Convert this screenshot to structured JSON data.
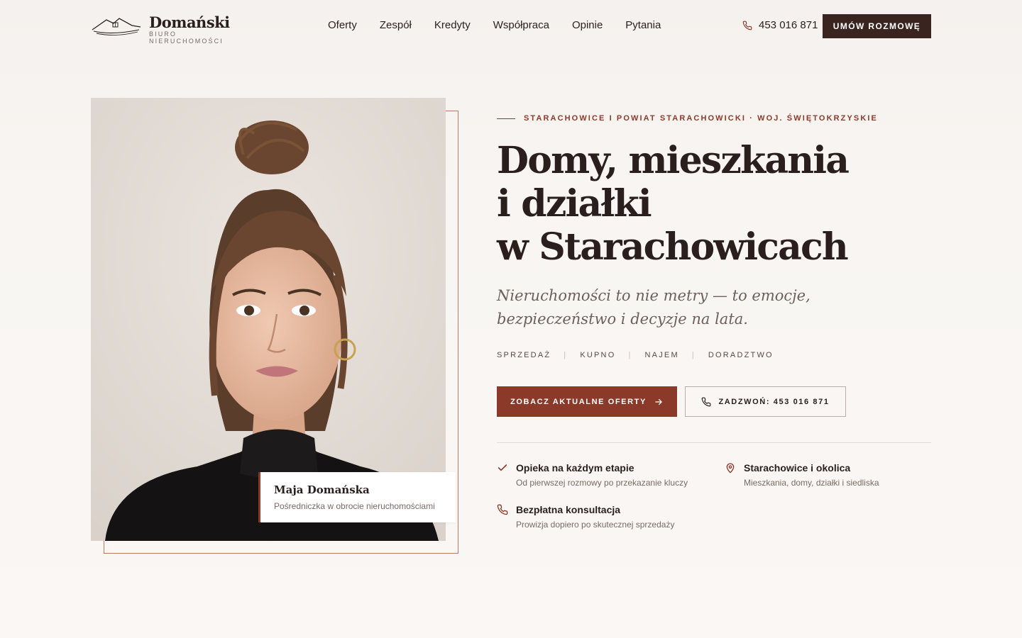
{
  "brand": {
    "name": "Domański",
    "subtitle": "BIURO NIERUCHOMOŚCI"
  },
  "nav": {
    "items": [
      "Oferty",
      "Zespół",
      "Kredyty",
      "Współpraca",
      "Opinie",
      "Pytania"
    ]
  },
  "header": {
    "phone": "453 016 871",
    "cta_label": "UMÓW ROZMOWĘ"
  },
  "agent": {
    "name": "Maja Domańska",
    "role": "Pośredniczka w obrocie nieruchomościami"
  },
  "hero": {
    "eyebrow": "STARACHOWICE I POWIAT STARACHOWICKI · WOJ. ŚWIĘTOKRZYSKIE",
    "headline_lines": [
      "Domy, mieszkania",
      "i działki",
      "w Starachowicach"
    ],
    "tagline_lines": [
      "Nieruchomości to nie metry — to emocje,",
      "bezpieczeństwo i decyzje na lata."
    ],
    "services": [
      "SPRZEDAŻ",
      "KUPNO",
      "NAJEM",
      "DORADZTWO"
    ],
    "separator": "|",
    "primary_cta": "ZOBACZ AKTUALNE OFERTY",
    "secondary_cta": "ZADZWOŃ: 453 016 871"
  },
  "features": [
    {
      "icon": "check-icon",
      "title": "Opieka na każdym etapie",
      "desc": "Od pierwszej rozmowy po przekazanie kluczy"
    },
    {
      "icon": "location-pin-icon",
      "title": "Starachowice i okolica",
      "desc": "Mieszkania, domy, działki i siedliska"
    },
    {
      "icon": "phone-icon",
      "title": "Bezpłatna konsultacja",
      "desc": "Prowizja dopiero po skutecznej sprzedaży"
    }
  ],
  "colors": {
    "accent": "#8b3a2a",
    "dark": "#3a2420",
    "text": "#2a1f1c",
    "muted": "#7a6a64",
    "background": "#faf7f5"
  }
}
